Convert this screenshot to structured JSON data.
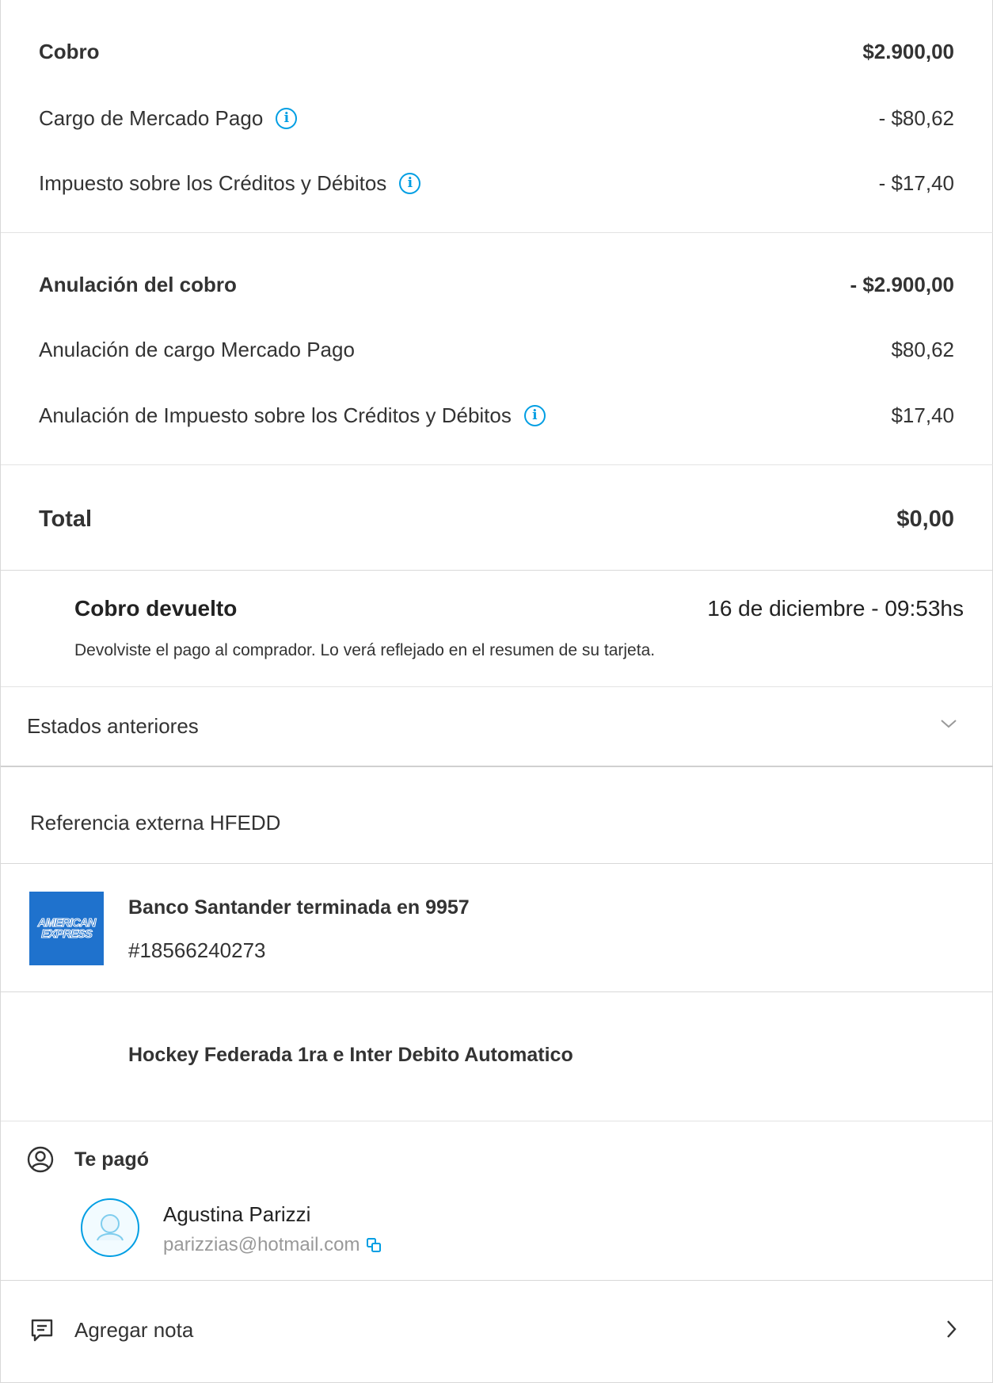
{
  "summary": {
    "charge_label": "Cobro",
    "charge_amount": "$2.900,00",
    "mp_fee_label": "Cargo de Mercado Pago",
    "mp_fee_amount": "- $80,62",
    "tax_label": "Impuesto sobre los Créditos y Débitos",
    "tax_amount": "- $17,40"
  },
  "cancellation": {
    "charge_label": "Anulación del cobro",
    "charge_amount": "- $2.900,00",
    "mp_fee_label": "Anulación de cargo Mercado Pago",
    "mp_fee_amount": "$80,62",
    "tax_label": "Anulación de Impuesto sobre los Créditos y Débitos",
    "tax_amount": "$17,40"
  },
  "total": {
    "label": "Total",
    "amount": "$0,00"
  },
  "status": {
    "title": "Cobro devuelto",
    "date": "16 de diciembre - 09:53hs",
    "description": "Devolviste el pago al comprador. Lo verá reflejado en el resumen de su tarjeta."
  },
  "previous_states": {
    "label": "Estados anteriores"
  },
  "reference": {
    "label": "Referencia externa HFEDD"
  },
  "payment_method": {
    "card_brand_line1": "AMERICAN",
    "card_brand_line2": "EXPRESS",
    "title": "Banco Santander terminada en 9957",
    "operation_id": "#18566240273"
  },
  "description": {
    "text": "Hockey Federada 1ra e Inter Debito Automatico"
  },
  "payer": {
    "heading": "Te pagó",
    "name": "Agustina Parizzi",
    "email": "parizzias@hotmail.com"
  },
  "note": {
    "label": "Agregar nota"
  },
  "colors": {
    "accent": "#009ee3",
    "amex": "#1f72cd",
    "text": "#333333",
    "muted": "#999999"
  },
  "icons": [
    "info-icon",
    "chevron-down-icon",
    "user-circle-icon",
    "avatar-icon",
    "copy-icon",
    "note-icon",
    "chevron-right-icon"
  ]
}
